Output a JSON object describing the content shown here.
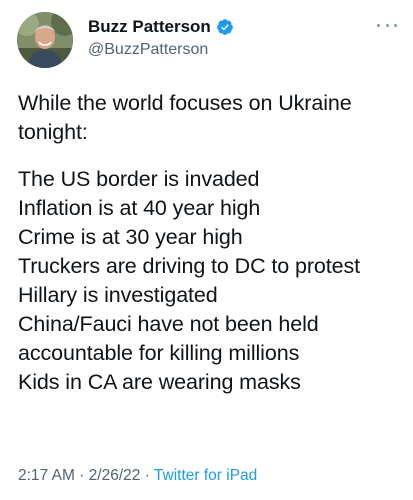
{
  "author": {
    "display_name": "Buzz Patterson",
    "handle": "@BuzzPatterson",
    "verified": true
  },
  "tweet": {
    "intro": "While the world focuses on Ukraine tonight:",
    "lines": [
      "The US border is invaded",
      "Inflation is at 40 year high",
      "Crime is at 30 year high",
      "Truckers are driving to DC to protest",
      "Hillary is investigated",
      "China/Fauci have not been held",
      "accountable for killing millions",
      "Kids in CA are wearing masks"
    ]
  },
  "meta": {
    "time": "2:17 AM",
    "separator": "·",
    "date": "2/26/22",
    "source": "Twitter for iPad"
  },
  "colors": {
    "verified_badge": "#1d9bf0",
    "secondary_text": "#536471",
    "link": "#1d9bf0"
  },
  "icons": {
    "verified": "verified-badge-icon",
    "more": "more-options-icon"
  }
}
